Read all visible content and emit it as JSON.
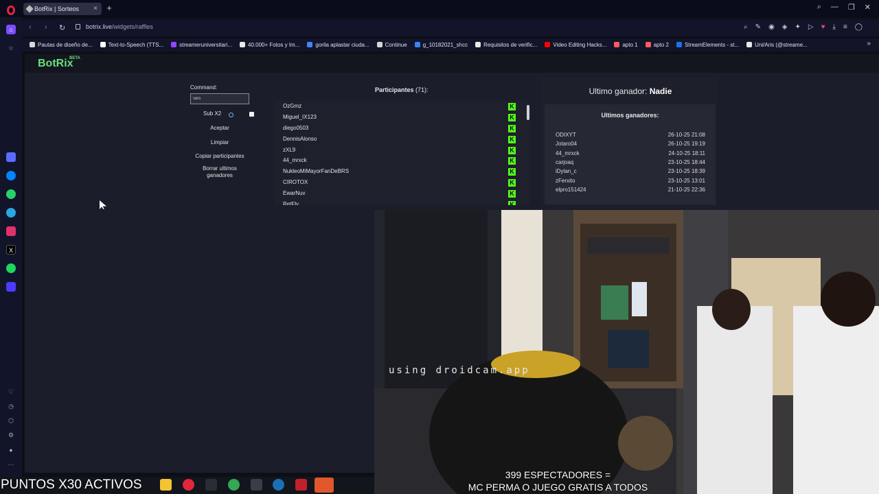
{
  "browser": {
    "tab_title": "BotRix | Sorteos",
    "url_host": "botrix.live",
    "url_path": "/widgets/raffles",
    "bookmarks": [
      {
        "label": "Pautas de diseño de...",
        "color": "#d7d7d7"
      },
      {
        "label": "Text-to-Speech (TTS...",
        "color": "#ffffff"
      },
      {
        "label": "streameruniversitari...",
        "color": "#9146ff"
      },
      {
        "label": "40.000+ Fotos y Im...",
        "color": "#e8e8e8"
      },
      {
        "label": "gorila aplastar ciuda...",
        "color": "#4285f4"
      },
      {
        "label": "Continue",
        "color": "#d7d7d7"
      },
      {
        "label": "g_10182021_shcc",
        "color": "#3b82f6"
      },
      {
        "label": "Requisitos de verific...",
        "color": "#e8e8e8"
      },
      {
        "label": "Video Editing Hacks...",
        "color": "#ff0000"
      },
      {
        "label": "apto 1",
        "color": "#ff5a5f"
      },
      {
        "label": "apto 2",
        "color": "#ff5a5f"
      },
      {
        "label": "StreamElements - st...",
        "color": "#1f6feb"
      },
      {
        "label": "Uni/Aris (@streame...",
        "color": "#e8e8e8"
      }
    ]
  },
  "app": {
    "logo": "BotRix",
    "logo_badge": "BETA"
  },
  "raffle": {
    "command_label": "Command:",
    "command_value": "!aris",
    "sub_label": "Sub X2",
    "accept_label": "Aceptar",
    "clear_label": "Limpiar",
    "copy_label": "Copiar participantes",
    "delete_label": "Borrar ultimos ganadores",
    "participants_title": "Participantes",
    "participants_count": "(71):",
    "participants": [
      "OzGmz",
      "Miguel_IX123",
      "diego0503",
      "DennisAlonso",
      "zXL9",
      "44_mrxck",
      "NukleoMiMayorFanDeBRS",
      "CIROTOX",
      "EwarNuv",
      "RetFly"
    ],
    "last_winner_label": "Ultimo ganador:",
    "last_winner_value": "Nadie",
    "winners_title": "Ultimos ganadores:",
    "winners": [
      {
        "name": "ODIXYT",
        "date": "26-10-25 21:08"
      },
      {
        "name": "Jotaro04",
        "date": "26-10-25 19:19"
      },
      {
        "name": "44_mrxck",
        "date": "24-10-25 18:11"
      },
      {
        "name": "carjoaq",
        "date": "23-10-25 18:44"
      },
      {
        "name": "iDylan_c",
        "date": "23-10-25 18:39"
      },
      {
        "name": "zFerxito",
        "date": "23-10-25 13:01"
      },
      {
        "name": "elpro151424",
        "date": "21-10-25 22:36"
      }
    ]
  },
  "stream": {
    "cam_watermark": "using droidcam.app",
    "overlay_line1": "399 ESPECTADORES =",
    "overlay_line2": "MC PERMA O JUEGO GRATIS A TODOS",
    "points_banner": "PUNTOS X30 ACTIVOS"
  },
  "colors": {
    "accent_green": "#53fc18",
    "opera_red": "#e3263b"
  }
}
